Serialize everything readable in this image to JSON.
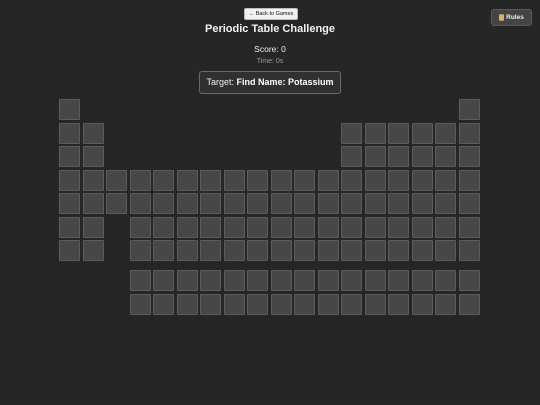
{
  "nav": {
    "back_label": "← Back to Games",
    "rules_label": "Rules",
    "rules_icon": "scroll-icon"
  },
  "header": {
    "title": "Periodic Table Challenge"
  },
  "stats": {
    "score_text": "Score: 0",
    "time_text": "Time: 0s"
  },
  "target": {
    "prefix": "Target: ",
    "value": "Find Name: Potassium"
  },
  "colors": {
    "background": "#262626",
    "cell": "#474747",
    "cell_border": "#5c5c5c"
  },
  "grid": {
    "columns": 18,
    "main_rows": [
      [
        1,
        18
      ],
      [
        1,
        2,
        13,
        14,
        15,
        16,
        17,
        18
      ],
      [
        1,
        2,
        13,
        14,
        15,
        16,
        17,
        18
      ],
      [
        1,
        2,
        3,
        4,
        5,
        6,
        7,
        8,
        9,
        10,
        11,
        12,
        13,
        14,
        15,
        16,
        17,
        18
      ],
      [
        1,
        2,
        3,
        4,
        5,
        6,
        7,
        8,
        9,
        10,
        11,
        12,
        13,
        14,
        15,
        16,
        17,
        18
      ],
      [
        1,
        2,
        4,
        5,
        6,
        7,
        8,
        9,
        10,
        11,
        12,
        13,
        14,
        15,
        16,
        17,
        18
      ],
      [
        1,
        2,
        4,
        5,
        6,
        7,
        8,
        9,
        10,
        11,
        12,
        13,
        14,
        15,
        16,
        17,
        18
      ]
    ],
    "f_block_rows": [
      [
        4,
        5,
        6,
        7,
        8,
        9,
        10,
        11,
        12,
        13,
        14,
        15,
        16,
        17,
        18
      ],
      [
        4,
        5,
        6,
        7,
        8,
        9,
        10,
        11,
        12,
        13,
        14,
        15,
        16,
        17,
        18
      ]
    ]
  }
}
